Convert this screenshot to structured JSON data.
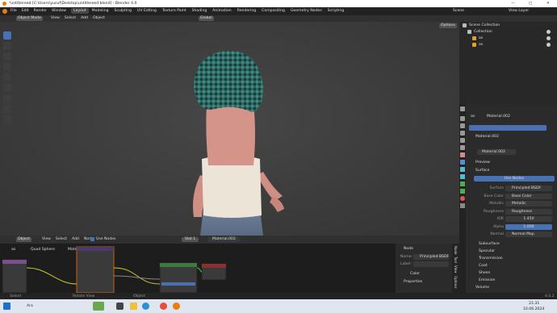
{
  "window": {
    "title": "*untitlereed [C:\\Users\\yusuf\\Desktop\\untitlereed.blend] - Blender 4.0",
    "minimize": "—",
    "maximize": "□",
    "close": "✕"
  },
  "menu": {
    "items": [
      "File",
      "Edit",
      "Render",
      "Window",
      "Help"
    ]
  },
  "workspace_tabs": [
    "Layout",
    "Modeling",
    "Sculpting",
    "UV Editing",
    "Texture Paint",
    "Shading",
    "Animation",
    "Rendering",
    "Compositing",
    "Geometry Nodes",
    "Scripting"
  ],
  "active_tab": "Layout",
  "scene": {
    "label": "Scene",
    "view_layer": "View Layer"
  },
  "viewport_header": {
    "mode": "Object Mode",
    "menus": [
      "View",
      "Select",
      "Add",
      "Object"
    ],
    "transform": "Global",
    "options": "Options"
  },
  "outliner": {
    "items": [
      {
        "label": "Scene Collection"
      },
      {
        "label": "Collection"
      },
      {
        "label": "as"
      },
      {
        "label": "as"
      }
    ]
  },
  "properties": {
    "object_name": "as",
    "material_slot": "Material.002",
    "material_field": "Material.002",
    "material_list_item": "Material.002",
    "sections": {
      "preview": "Preview",
      "surface": "Surface"
    },
    "use_nodes": "Use Nodes",
    "rows": [
      {
        "label": "Surface",
        "value": "Principled BSDF"
      },
      {
        "label": "Base Color",
        "value": "Base Color"
      },
      {
        "label": "Metallic",
        "value": "Metallic"
      },
      {
        "label": "Roughness",
        "value": "Roughness"
      },
      {
        "label": "IOR",
        "value": "1.450"
      },
      {
        "label": "Alpha",
        "value": "1.000"
      },
      {
        "label": "Normal",
        "value": "Normal Map"
      }
    ],
    "subsections": [
      "Subsurface",
      "Specular",
      "Transmission",
      "Coat",
      "Sheen",
      "Emission"
    ],
    "volume": "Volume"
  },
  "node_editor_header": {
    "object": "Object",
    "menus": [
      "View",
      "Select",
      "Add",
      "Node"
    ],
    "use_nodes": "Use Nodes",
    "slot": "Slot 1",
    "material": "Material.002"
  },
  "node_breadcrumb": {
    "obj": "as",
    "mesh": "Quad Sphere",
    "mat": "Material.002"
  },
  "node_panel": {
    "title": "Node",
    "name_label": "Name:",
    "name_value": "Principled BSDF",
    "label_label": "Label:",
    "colors": "Color",
    "properties": "Properties"
  },
  "side_tabs": [
    "Node",
    "Tool",
    "View",
    "Options"
  ],
  "status_bar": {
    "select": "Select",
    "rotate": "Rotate View",
    "object": "Object",
    "version": "4.0.2"
  },
  "taskbar": {
    "search": "Ara",
    "time": "21:31",
    "date": "10.06.2024"
  },
  "colors": {
    "accent": "#4772b3",
    "active_blue": "#4b6fb0",
    "header": "#303030",
    "panel": "#2a2a2a",
    "viewport": "#3d3d3d"
  }
}
